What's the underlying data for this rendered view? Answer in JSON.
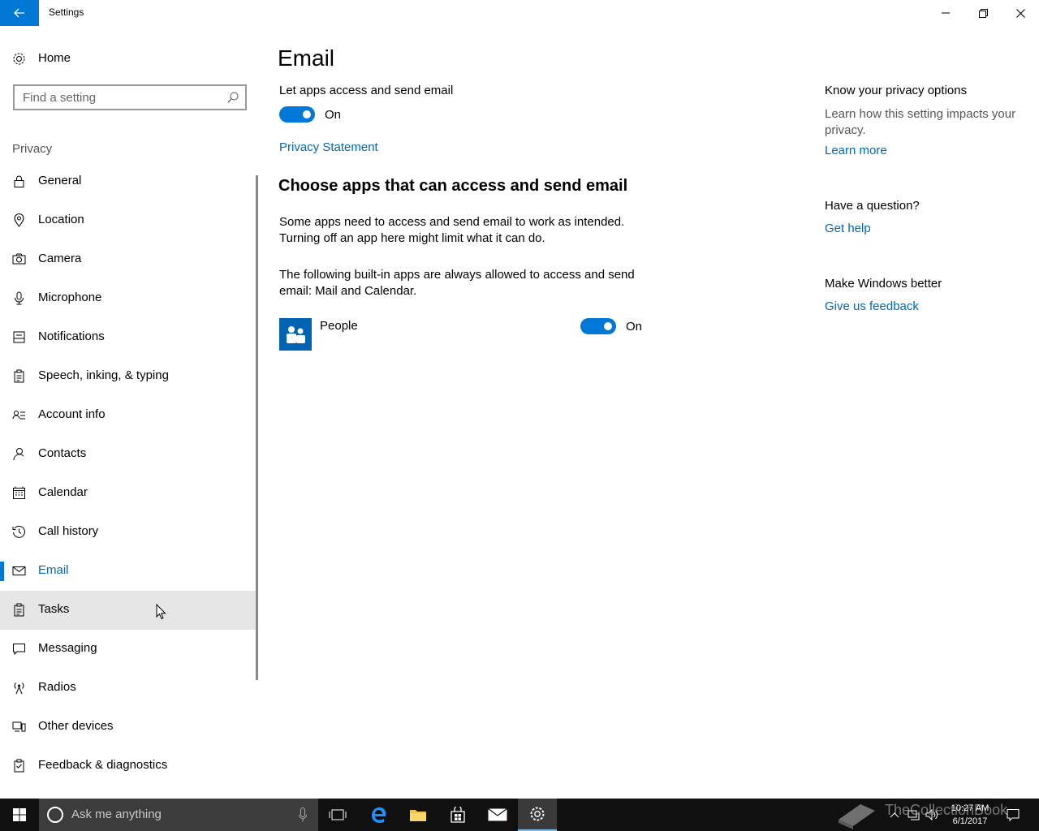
{
  "window": {
    "title": "Settings"
  },
  "sidebar": {
    "home_label": "Home",
    "search_placeholder": "Find a setting",
    "group_label": "Privacy",
    "items": [
      {
        "label": "General",
        "icon": "lock-icon"
      },
      {
        "label": "Location",
        "icon": "location-icon"
      },
      {
        "label": "Camera",
        "icon": "camera-icon"
      },
      {
        "label": "Microphone",
        "icon": "microphone-icon"
      },
      {
        "label": "Notifications",
        "icon": "notification-icon"
      },
      {
        "label": "Speech, inking, & typing",
        "icon": "clipboard-icon"
      },
      {
        "label": "Account info",
        "icon": "account-info-icon"
      },
      {
        "label": "Contacts",
        "icon": "contacts-icon"
      },
      {
        "label": "Calendar",
        "icon": "calendar-icon"
      },
      {
        "label": "Call history",
        "icon": "history-icon"
      },
      {
        "label": "Email",
        "icon": "mail-icon"
      },
      {
        "label": "Tasks",
        "icon": "tasks-icon"
      },
      {
        "label": "Messaging",
        "icon": "message-icon"
      },
      {
        "label": "Radios",
        "icon": "radio-antenna-icon"
      },
      {
        "label": "Other devices",
        "icon": "devices-icon"
      },
      {
        "label": "Feedback & diagnostics",
        "icon": "feedback-icon"
      }
    ],
    "selected": "Email",
    "hovered": "Tasks"
  },
  "main": {
    "title": "Email",
    "master_toggle_label": "Let apps access and send email",
    "master_toggle_state": "On",
    "privacy_link": "Privacy Statement",
    "section_title": "Choose apps that can access and send email",
    "para1": "Some apps need to access and send email to work as intended. Turning off an app here might limit what it can do.",
    "para2": "The following built-in apps are always allowed to access and send email: Mail and Calendar.",
    "apps": [
      {
        "name": "People",
        "state": "On"
      }
    ]
  },
  "side_panel": {
    "privacy_heading": "Know your privacy options",
    "privacy_text": "Learn how this setting impacts your privacy.",
    "learn_more": "Learn more",
    "question_heading": "Have a question?",
    "get_help": "Get help",
    "better_heading": "Make Windows better",
    "feedback": "Give us feedback"
  },
  "taskbar": {
    "search_placeholder": "Ask me anything",
    "time": "10:27 AM",
    "date": "6/1/2017",
    "watermark": "TheCollectionBook"
  },
  "colors": {
    "accent": "#0078d7",
    "link": "#0067b8"
  }
}
